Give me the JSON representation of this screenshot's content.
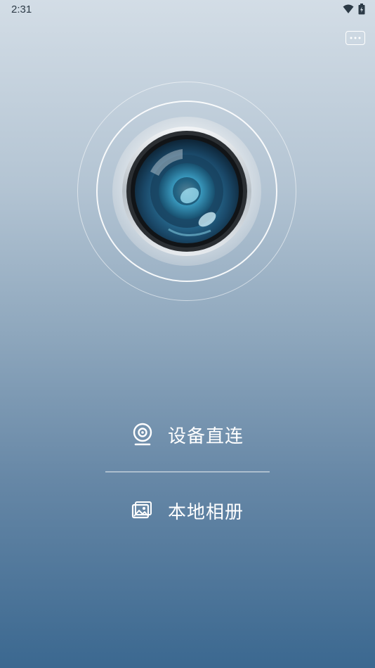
{
  "status_bar": {
    "time": "2:31",
    "icons": [
      "wifi-icon",
      "battery-icon"
    ]
  },
  "header": {
    "more_icon": "more-dots-icon"
  },
  "hero": {
    "icon": "camera-lens-icon"
  },
  "menu": {
    "items": [
      {
        "label": "设备直连",
        "icon": "webcam-icon"
      },
      {
        "label": "本地相册",
        "icon": "photo-album-icon"
      }
    ]
  },
  "colors": {
    "gradient_top": "#d3dde6",
    "gradient_bottom": "#3b6890",
    "text": "#ffffff"
  }
}
